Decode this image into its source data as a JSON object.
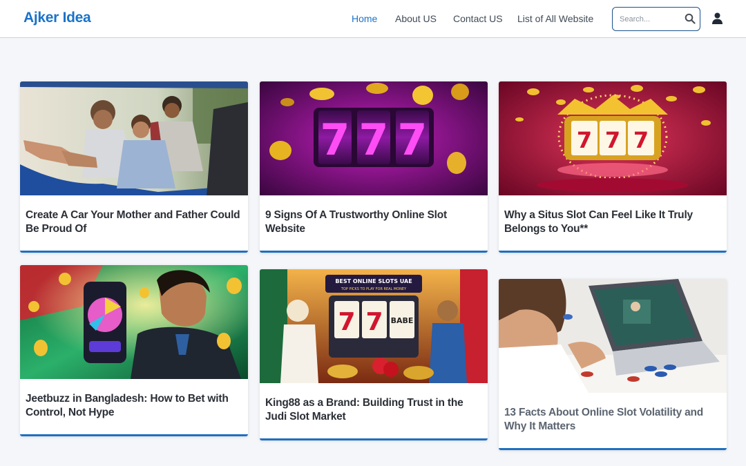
{
  "site": {
    "logo": "Ajker Idea"
  },
  "nav": {
    "items": [
      {
        "label": "Home",
        "active": true
      },
      {
        "label": "About US",
        "active": false
      },
      {
        "label": "Contact US",
        "active": false
      },
      {
        "label": "List of All Website",
        "active": false
      }
    ]
  },
  "search": {
    "placeholder": "Search...",
    "value": ""
  },
  "colors": {
    "accent": "#1a73c8",
    "card_border": "#1e6fc0",
    "background": "#f4f6f9"
  },
  "posts": [
    {
      "title": "Create A Car Your Mother and Father Could Be Proud Of",
      "image": "family-in-car-photo"
    },
    {
      "title": "9 Signs Of A Trustworthy Online Slot Website",
      "image": "purple-777-slot-reels"
    },
    {
      "title": "Why a Situs Slot Can Feel Like It Truly Belongs to You**",
      "image": "golden-slot-machine-crown"
    },
    {
      "title": "Jeetbuzz in Bangladesh: How to Bet with Control, Not Hype",
      "image": "man-holding-phone-wheel"
    },
    {
      "title": "King88 as a Brand: Building Trust in the Judi Slot Market",
      "image": "best-online-slots-uae-illustration",
      "banner_text": "BEST ONLINE SLOTS UAE",
      "banner_sub": "TOP PICKS TO PLAY FOR REAL MONEY",
      "reel_text": "BABE"
    },
    {
      "title": "13 Facts About Online Slot Volatility and Why It Matters",
      "image": "man-at-laptop-casino"
    }
  ]
}
